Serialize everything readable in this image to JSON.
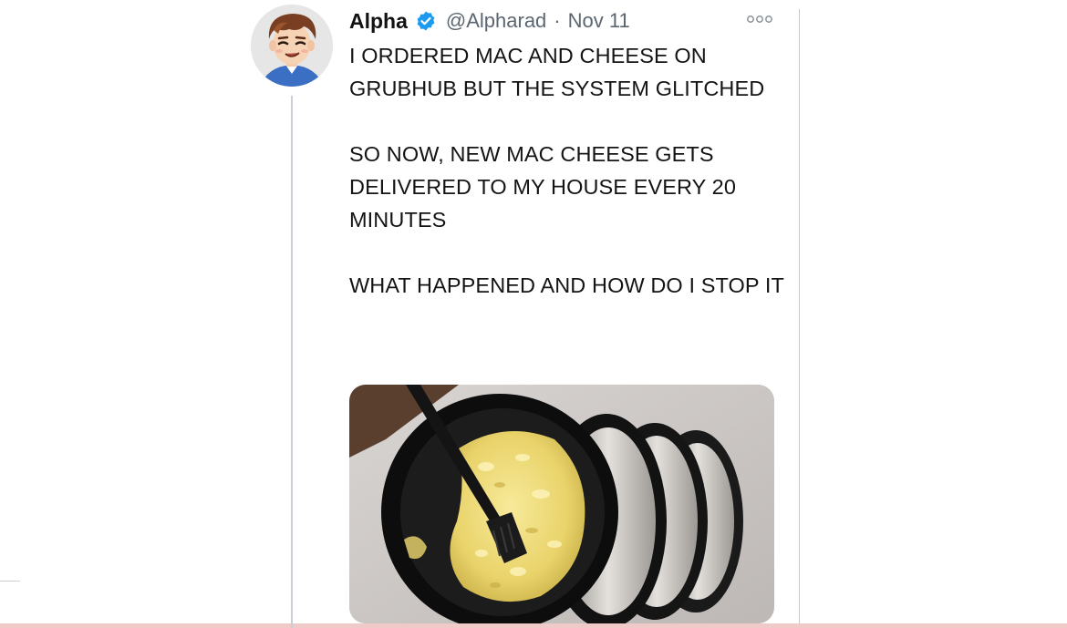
{
  "tweet": {
    "author_name": "Alpha",
    "handle": "@Alpharad",
    "separator": "·",
    "date": "Nov 11",
    "paragraphs": [
      "I ORDERED MAC AND CHEESE ON GRUBHUB BUT THE SYSTEM GLITCHED",
      "SO NOW, NEW MAC CHEESE GETS DELIVERED TO MY HOUSE EVERY 20 MINUTES",
      "WHAT HAPPENED AND HOW DO I STOP IT"
    ]
  },
  "icons": {
    "verified": "verified-badge-icon",
    "more": "more-options-icon"
  },
  "colors": {
    "verified_blue": "#1d9bf0",
    "text": "#141414",
    "secondary_text": "#5b6670"
  }
}
